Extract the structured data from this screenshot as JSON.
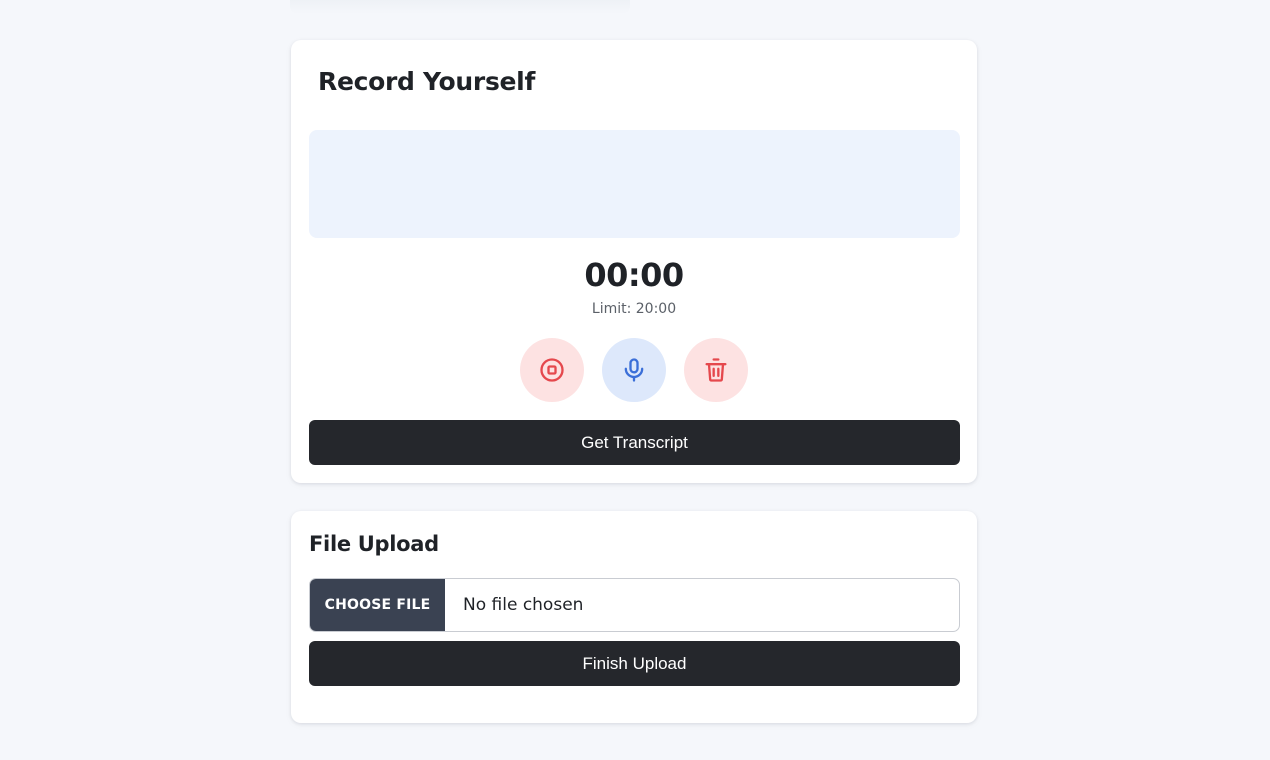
{
  "record": {
    "title": "Record Yourself",
    "timer": "00:00",
    "limit": "Limit: 20:00",
    "stop_icon": "stop-circle-icon",
    "mic_icon": "microphone-icon",
    "delete_icon": "trash-icon",
    "transcript_label": "Get Transcript"
  },
  "upload": {
    "title": "File Upload",
    "choose_label": "CHOOSE FILE",
    "file_status": "No file chosen",
    "finish_label": "Finish Upload"
  },
  "colors": {
    "page_background": "#f5f7fb",
    "visualizer_background": "#edf3fd",
    "button_dark": "#25272c",
    "danger_red": "#e5484d",
    "danger_red_bg": "#fde2e2",
    "mic_blue": "#3b6fd8",
    "mic_blue_bg": "#dde8fb",
    "choose_file_bg": "#3a4252"
  }
}
